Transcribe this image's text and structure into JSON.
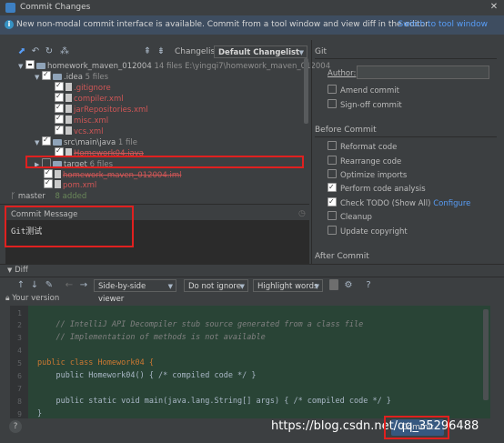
{
  "window": {
    "title": "Commit Changes"
  },
  "infobar": {
    "message": "New non-modal commit interface is available. Commit from a tool window and view diff in the editor.",
    "link": "Switch to tool window"
  },
  "toolbar": {
    "changelist_label": "Changelist:",
    "changelist_value": "Default Changelist",
    "git_label": "Git"
  },
  "tree": {
    "root": {
      "name": "homework_maven_012004",
      "count": "14 files",
      "path": "E:\\yingqi7\\homework_maven_012004"
    },
    "idea": {
      "name": ".idea",
      "count": "5 files"
    },
    "idea_files": [
      ".gitignore",
      "compiler.xml",
      "jarRepositories.xml",
      "misc.xml",
      "vcs.xml"
    ],
    "src": {
      "name": "src\\main\\java",
      "count": "1 file"
    },
    "src_file": "Homework04.java",
    "target": {
      "name": "target",
      "count": "6 files"
    },
    "iml": "homework_maven_012004.iml",
    "pom": "pom.xml"
  },
  "branch": {
    "name": "master",
    "added": "8 added"
  },
  "commit_message": {
    "label": "Commit Message",
    "value": "Git测试"
  },
  "git_panel": {
    "author_label": "Author:",
    "author_value": "",
    "amend": "Amend commit",
    "signoff": "Sign-off commit"
  },
  "before_commit": {
    "label": "Before Commit",
    "options": [
      {
        "label": "Reformat code",
        "checked": false
      },
      {
        "label": "Rearrange code",
        "checked": false
      },
      {
        "label": "Optimize imports",
        "checked": false
      },
      {
        "label": "Perform code analysis",
        "checked": true
      },
      {
        "label": "Check TODO (Show All)",
        "checked": true
      },
      {
        "label": "Cleanup",
        "checked": false
      },
      {
        "label": "Update copyright",
        "checked": false
      }
    ],
    "configure_link": "Configure"
  },
  "after_commit": {
    "label": "After Commit"
  },
  "diff": {
    "label": "Diff",
    "viewer": "Side-by-side viewer",
    "ignore": "Do not ignore",
    "highlight": "Highlight words",
    "version_label": "Your version"
  },
  "code_lines": [
    {
      "n": "1",
      "text": ""
    },
    {
      "n": "2",
      "text": "    // IntelliJ API Decompiler stub source generated from a class file"
    },
    {
      "n": "3",
      "text": "    // Implementation of methods is not available"
    },
    {
      "n": "4",
      "text": ""
    },
    {
      "n": "5",
      "text": "public class Homework04 {"
    },
    {
      "n": "6",
      "text": "    public Homework04() { /* compiled code */ }"
    },
    {
      "n": "7",
      "text": ""
    },
    {
      "n": "8",
      "text": "    public static void main(java.lang.String[] args) { /* compiled code */ }"
    },
    {
      "n": "9",
      "text": "}"
    }
  ],
  "footer": {
    "help": "?",
    "commit_button": "Commit",
    "watermark": "https://blog.csdn.net/qq_35296488"
  },
  "colors": {
    "accent": "#589df6",
    "highlight_box": "#e0201f",
    "modified": "#d05656",
    "code_bg": "#2b2b2b",
    "added_line": "#294436"
  }
}
